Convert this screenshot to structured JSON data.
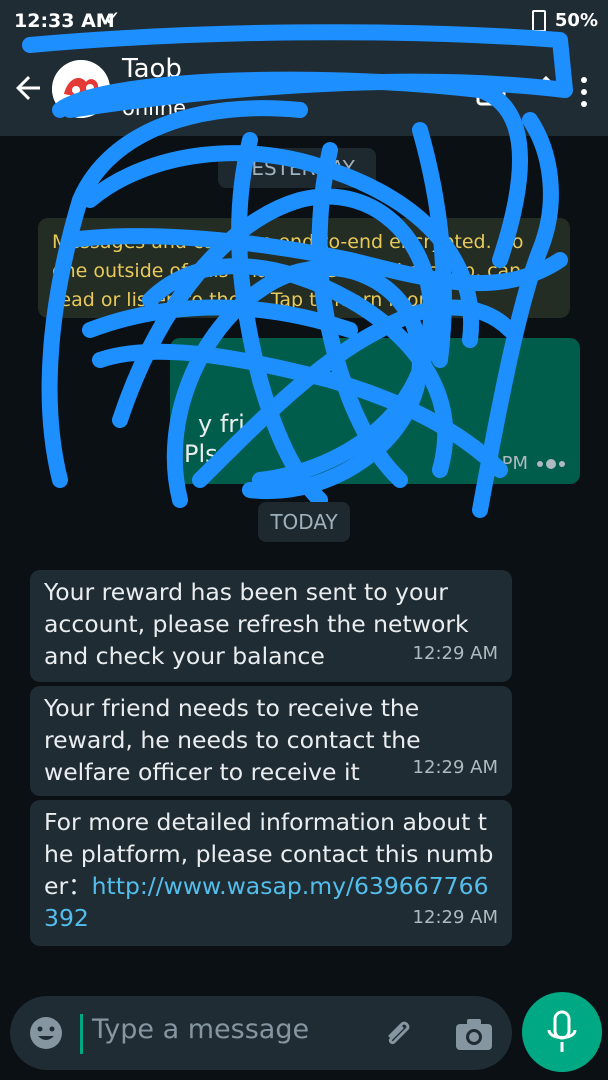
{
  "status_bar": {
    "time": "12:33 AM",
    "battery": "50%",
    "check_glyph": "✓"
  },
  "header": {
    "contact_name": "Taob",
    "contact_status": "online",
    "back_icon": "arrow-left-icon"
  },
  "chat": {
    "yesterday_chip": "YESTERDAY",
    "encryption_notice": "Messages and calls are end-to-end encrypted. No one outside of this chat, not even WhatsApp, can read or listen to them. Tap to learn more.",
    "outgoing_partial_1": "y fri",
    "outgoing_partial_2": "Pls",
    "outgoing_time_partial": "PM",
    "today_chip": "TODAY",
    "messages": [
      {
        "text": "Your reward has been sent to your account, please refresh the network and check your balance",
        "time": "12:29 AM"
      },
      {
        "text": "Your friend needs to receive the reward, he needs to contact the welfare officer to receive it",
        "time": "12:29 AM"
      },
      {
        "text": "For more detailed information about the platform, please contact this number：",
        "link": "http://www.wasap.my/639667766392",
        "time": "12:29 AM"
      }
    ]
  },
  "composer": {
    "placeholder": "Type a message"
  },
  "colors": {
    "background": "#0a1014",
    "header": "#1f2c34",
    "incoming_bubble": "#202c33",
    "outgoing_bubble": "#005c4b",
    "accent": "#00a884",
    "link": "#53bdeb",
    "scribble": "#1e8fff"
  }
}
